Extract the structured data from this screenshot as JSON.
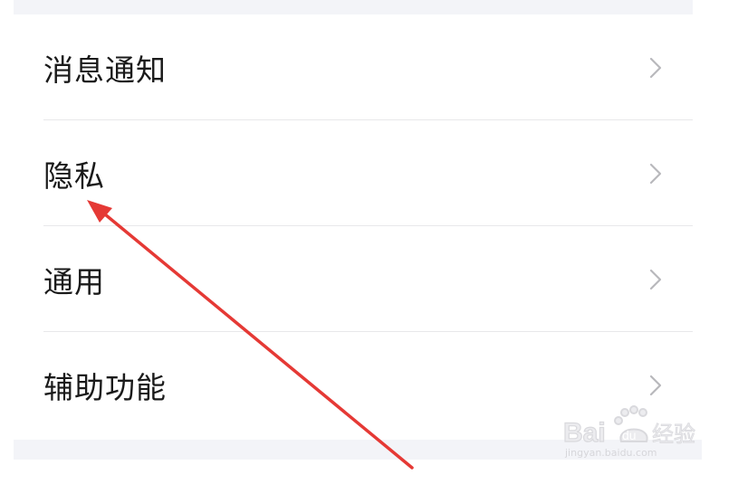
{
  "settings": {
    "items": [
      {
        "label": "消息通知",
        "icon": "chevron-right-icon"
      },
      {
        "label": "隐私",
        "icon": "chevron-right-icon"
      },
      {
        "label": "通用",
        "icon": "chevron-right-icon"
      },
      {
        "label": "辅助功能",
        "icon": "chevron-right-icon"
      }
    ]
  },
  "annotation": {
    "type": "arrow",
    "color": "#e53935",
    "points_to": "隐私"
  },
  "watermark": {
    "brand": "Baidu经验",
    "url": "jingyan.baidu.com"
  },
  "colors": {
    "background": "#ffffff",
    "band": "#f3f4f8",
    "text": "#1a1a1a",
    "chevron": "#b8b8bc",
    "divider": "#e8e8ea"
  }
}
